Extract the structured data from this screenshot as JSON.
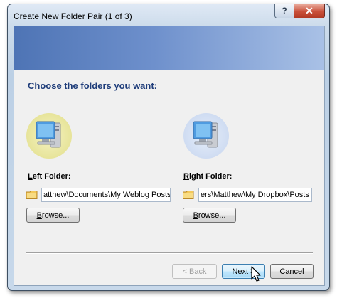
{
  "window": {
    "title": "Create New Folder Pair (1 of 3)",
    "help_glyph": "?",
    "close_glyph": "✕"
  },
  "content": {
    "heading": "Choose the folders you want:",
    "left": {
      "label_key": "L",
      "label_rest": "eft Folder:",
      "path": "atthew\\Documents\\My Weblog Posts",
      "browse_key": "B",
      "browse_rest": "rowse..."
    },
    "right": {
      "label_key": "R",
      "label_rest": "ight Folder:",
      "path": "ers\\Matthew\\My Dropbox\\Posts",
      "browse_key": "B",
      "browse_rest": "rowse..."
    }
  },
  "footer": {
    "back_prefix": "< ",
    "back_key": "B",
    "back_rest": "ack",
    "next_key": "N",
    "next_rest": "ext >",
    "cancel": "Cancel"
  }
}
